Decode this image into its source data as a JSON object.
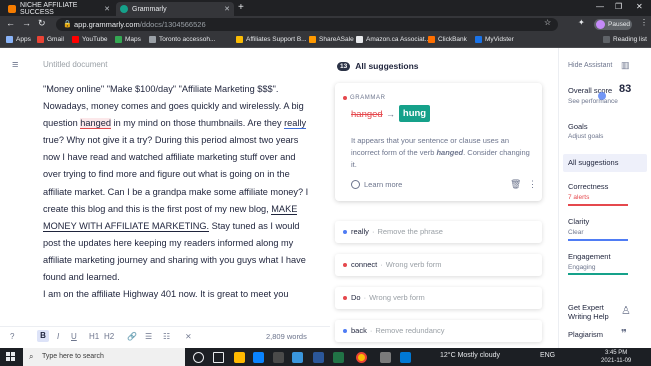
{
  "browser": {
    "tabs": [
      {
        "title": "NICHE AFFILIATE SUCCESS",
        "favicon_color": "#f57c00"
      },
      {
        "title": "Grammarly",
        "favicon_color": "#15a18a"
      }
    ],
    "url_host": "app.grammarly.com",
    "url_path": "/ddocs/1304566526",
    "profile_label": "Paused",
    "bookmarks": [
      "Apps",
      "Gmail",
      "YouTube",
      "Maps",
      "Toronto accessoh...",
      "Affiliates Support B...",
      "ShareASale",
      "Amazon.ca Associat...",
      "ClickBank",
      "MyVidster"
    ],
    "reading_list": "Reading list"
  },
  "editor": {
    "doc_title": "Untitled document",
    "p1_a": "\"Money online\" \"Make $100/day\" \"Affiliate Marketing $$$\". Nowadays, money comes and goes quickly and wirelessly. A big question ",
    "p1_flag": "hanged",
    "p1_b": " in my mind on those thumbnails. Are they ",
    "p1_really": "really",
    "p1_c": " true? Why not give it a try? During this period almost two years now I have read and watched affiliate marketing stuff over and over trying to find more and figure out what is going on in the affiliate market. Can I be a grandpa make some affiliate money? I create this blog and this is the first post of my new blog, ",
    "p1_link": "MAKE MONEY WITH AFFILIATE MARKETING.",
    "p1_d": " Stay tuned as I would post the updates here keeping my readers informed along my affiliate marketing journey and sharing with you guys what I have found and learned.",
    "p2": "I am on the affiliate Highway 401 now. It is great to meet you",
    "word_count": "2,809 words",
    "format_bold": "B",
    "format_italic": "I",
    "format_underline": "U",
    "format_h1": "H1",
    "format_h2": "H2"
  },
  "suggestions": {
    "count": "13",
    "header": "All suggestions",
    "main_card": {
      "category": "GRAMMAR",
      "original": "hanged",
      "replacement": "hung",
      "explanation": "It appears that your sentence or clause uses an incorrect form of the verb hanged. Consider changing it.",
      "learn_more": "Learn more"
    },
    "items": [
      {
        "word": "really",
        "desc": "Remove the phrase",
        "dot": "#4f7cf4"
      },
      {
        "word": "connect",
        "desc": "Wrong verb form",
        "dot": "#e5484d"
      },
      {
        "word": "Do",
        "desc": "Wrong verb form",
        "dot": "#e5484d"
      },
      {
        "word": "back",
        "desc": "Remove redundancy",
        "dot": "#4f7cf4"
      }
    ]
  },
  "assistant": {
    "hide": "Hide Assistant",
    "overall_score_label": "Overall score",
    "overall_score": "83",
    "see_performance": "See performance",
    "goals": "Goals",
    "adjust_goals": "Adjust goals",
    "all_suggestions": "All suggestions",
    "correctness": "Correctness",
    "correctness_sub": "7 alerts",
    "clarity": "Clarity",
    "clarity_sub": "Clear",
    "engagement": "Engagement",
    "engagement_sub": "Engaging",
    "get_expert": "Get Expert",
    "writing_help": "Writing Help",
    "plagiarism": "Plagiarism"
  },
  "taskbar": {
    "search_placeholder": "Type here to search",
    "weather": "12°C  Mostly cloudy",
    "lang": "ENG",
    "time": "3:45 PM",
    "date": "2021-11-09"
  }
}
